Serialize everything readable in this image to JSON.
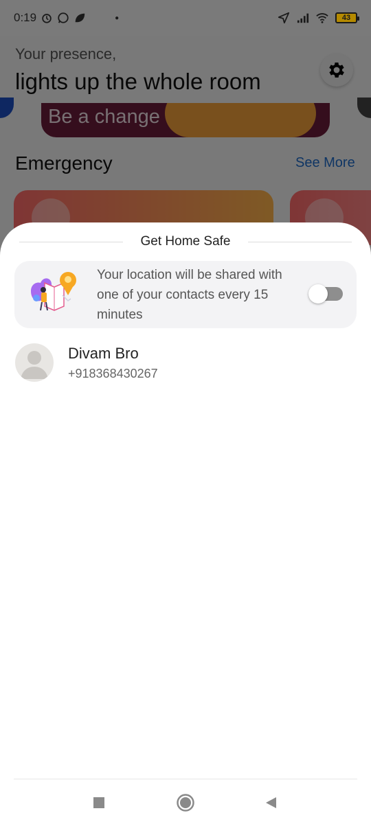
{
  "status_bar": {
    "time": "0:19",
    "battery_level": "43",
    "icons": [
      "alarm-icon",
      "whatsapp-icon",
      "leaf-icon",
      "location-icon",
      "signal-icon",
      "wifi-icon",
      "battery-icon"
    ]
  },
  "background_app": {
    "greeting_sub": "Your presence,",
    "greeting_main": "lights up the whole room",
    "banner_text": "Be a change",
    "section_title": "Emergency",
    "see_more": "See More"
  },
  "sheet": {
    "title": "Get Home Safe",
    "share_card": {
      "text": "Your location will be shared with one of your contacts every 15 minutes",
      "toggle_on": false
    },
    "contact": {
      "name": "Divam Bro",
      "phone": "+918368430267"
    }
  },
  "colors": {
    "accent_link": "#1e6bc9",
    "toggle_off": "#8e8e8e",
    "card_bg": "#f3f3f5"
  }
}
